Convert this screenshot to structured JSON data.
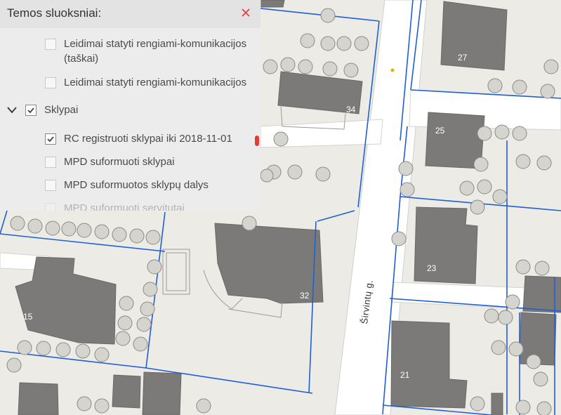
{
  "panel": {
    "title": "Temos sluoksniai:",
    "close_icon": "close-icon",
    "layers": [
      {
        "label": "Leidimai statyti rengiami-komunikacijos (taškai)",
        "checked": false
      },
      {
        "label": "Leidimai statyti rengiami-komunikacijos",
        "checked": false
      },
      {
        "label": "Sklypai",
        "checked": true,
        "group": true,
        "expanded": true
      },
      {
        "label": "RC registruoti sklypai iki 2018-11-01",
        "checked": true
      },
      {
        "label": "MPD suformuoti sklypai",
        "checked": false
      },
      {
        "label": "MPD suformuotos sklypų dalys",
        "checked": false
      },
      {
        "label": "MPD suformuoti servitutai",
        "checked": false
      }
    ],
    "accent": "#e53935"
  },
  "map": {
    "street_name": "Širvintų g.",
    "house_numbers": [
      "27",
      "34",
      "25",
      "23",
      "32",
      "15",
      "21"
    ],
    "parcel_line_color": "#1f5fd6",
    "building_color": "#7b7a78"
  }
}
